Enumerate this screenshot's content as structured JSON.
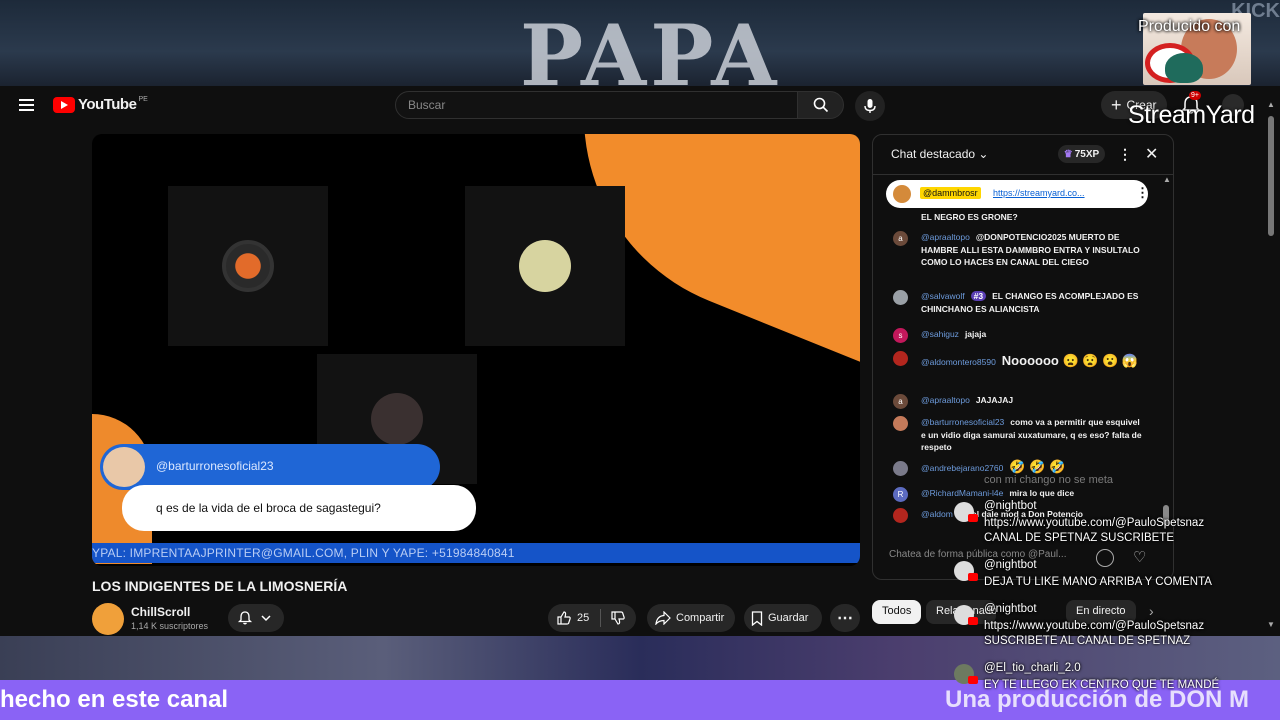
{
  "stream": {
    "banner_text": "PAPA",
    "banner_corner": "KICK",
    "produced_with": "Producido con",
    "streamyard": "StreamYard",
    "bottom_left": "hecho en este canal",
    "bottom_right": "Una producción de DON M"
  },
  "youtube": {
    "logo": "YouTube",
    "country": "PE",
    "search_placeholder": "Buscar",
    "create_label": "Crear",
    "notif_count": "9+"
  },
  "video": {
    "participant_name": "@barturronesoficial23",
    "message": "q es de la vida de el broca de sagastegui?",
    "ticker": "YPAL: IMPRENTAAJPRINTER@GMAIL.COM, PLIN Y YAPE: +51984840841",
    "title": "LOS INDIGENTES DE LA LIMOSNERÍA",
    "channel": "ChillScroll",
    "subscribers": "1,14 K suscriptores",
    "likes": "25",
    "share": "Compartir",
    "save": "Guardar"
  },
  "chat": {
    "title": "Chat destacado",
    "xp": "75XP",
    "pinned_user": "@dammbrosr",
    "pinned_link": "https://streamyard.co...",
    "input_placeholder": "Chatea de forma pública como @Paul...",
    "messages": [
      {
        "initial": "",
        "color": "#000000",
        "author": "",
        "text": "EL NEGRO ES GRONE?"
      },
      {
        "initial": "a",
        "color": "#6b4a3a",
        "author": "@apraaltopo",
        "text": "@DONPOTENCIO2025 MUERTO DE HAMBRE ALLI ESTA DAMMBRO ENTRA Y INSULTALO COMO LO HACES EN CANAL DEL CIEGO"
      },
      {
        "initial": "",
        "color": "#9aa0a6",
        "author": "@salvawolf",
        "badge": "#3",
        "text": "EL CHANGO ES ACOMPLEJADO ES CHINCHANO ES ALIANCISTA"
      },
      {
        "initial": "s",
        "color": "#c2185b",
        "author": "@sahiguz",
        "text": "jajaja"
      },
      {
        "initial": "",
        "color": "#b3261e",
        "author": "@aldomontero8590",
        "text": "Noooooo 😦 😧 😮 😱"
      },
      {
        "initial": "a",
        "color": "#6b4a3a",
        "author": "@apraaltopo",
        "text": "JAJAJAJ"
      },
      {
        "initial": "",
        "color": "#c47a5a",
        "author": "@barturronesoficial23",
        "text": "como va a permitir que esquivel e un vidio diga samurai xuxatumare, q es eso? falta de respeto"
      },
      {
        "initial": "",
        "color": "#7a7a8a",
        "author": "@andrebejarano2760",
        "text": "🤣 🤣 🤣"
      },
      {
        "initial": "R",
        "color": "#5c6bc0",
        "author": "@RichardMamani-l4e",
        "text": "mira lo que dice"
      },
      {
        "initial": "",
        "color": "#b3261e",
        "author": "@aldom",
        "text": "Jarol dale mod a Don Potencio"
      }
    ]
  },
  "chips": {
    "all": "Todos",
    "related": "Relacionados",
    "live": "En directo"
  },
  "overlay": {
    "ghost_text": "con mi chango no se meta",
    "messages": [
      {
        "name": "@nightbot",
        "text": "https://www.youtube.com/@PauloSpetsnaz CANAL DE SPETNAZ SUSCRIBETE"
      },
      {
        "name": "@nightbot",
        "text": "DEJA TU LIKE MANO ARRIBA Y COMENTA"
      },
      {
        "name": "@nightbot",
        "text": "https://www.youtube.com/@PauloSpetsnaz SUSCRIBETE AL CANAL DE SPETNAZ"
      },
      {
        "name": "@El_tio_charli_2.0",
        "text": "EY TE LLEGO EK CENTRO QUE TE MANDÉ"
      }
    ]
  }
}
